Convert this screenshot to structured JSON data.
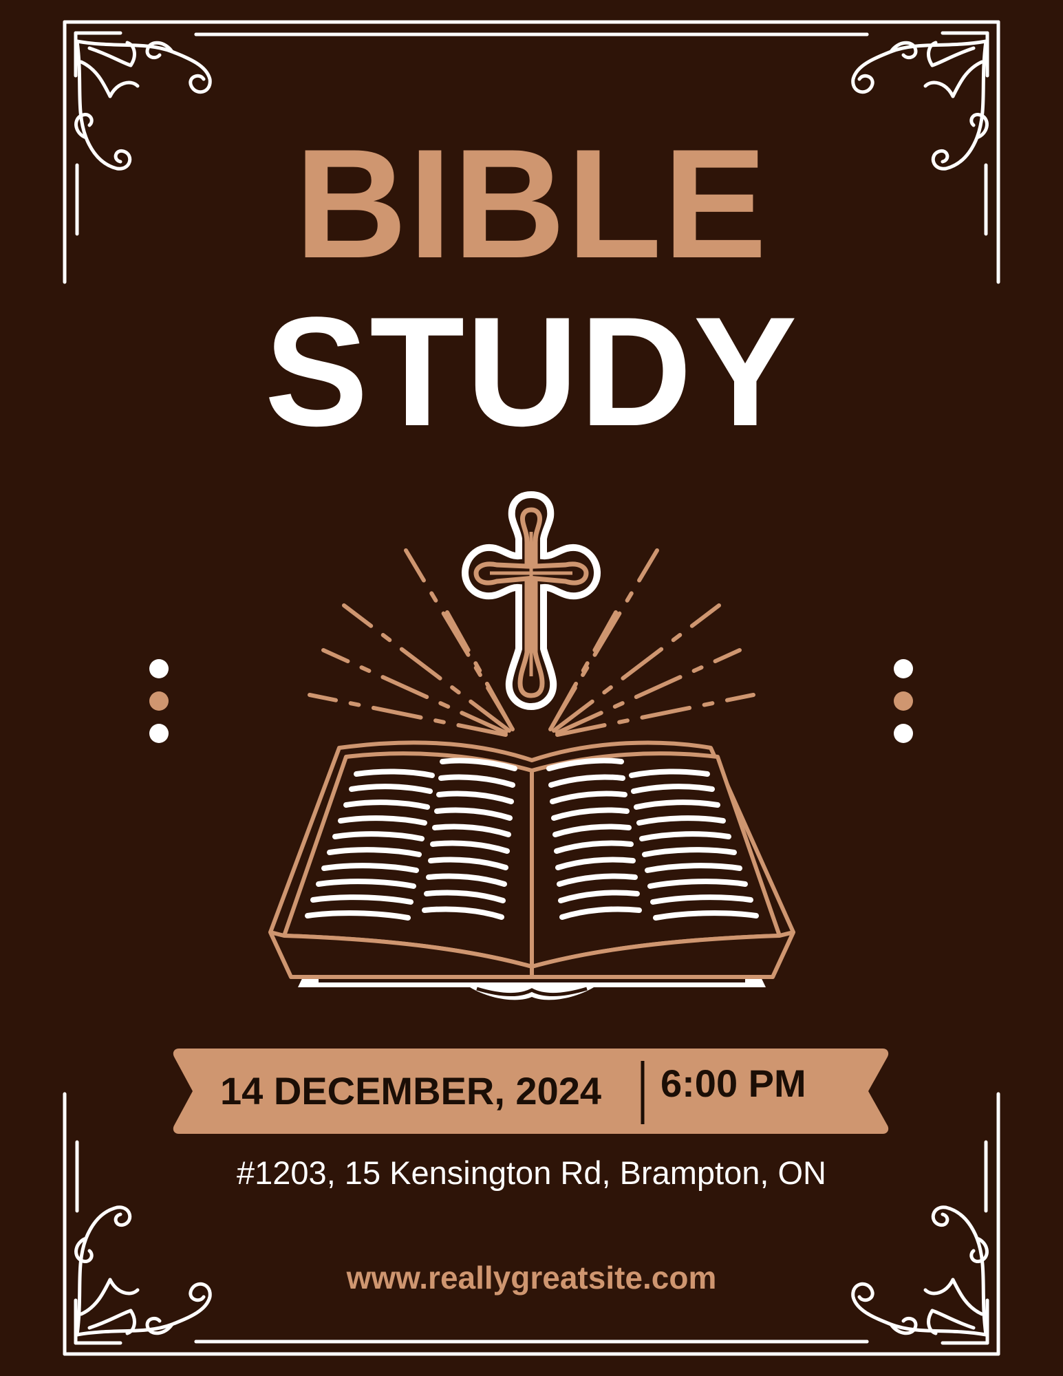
{
  "flyer": {
    "title_line1": "BIBLE",
    "title_line2": "STUDY",
    "date": "14 DECEMBER, 2024",
    "time": "6:00 PM",
    "address": "#1203, 15 Kensington Rd, Brampton, ON",
    "website": "www.reallygreatsite.com"
  },
  "colors": {
    "background": "#2e1408",
    "accent": "#cf9670",
    "white": "#ffffff",
    "dark_text": "#1b0e06"
  },
  "icons": [
    "corner-ornament-icon",
    "cross-icon",
    "open-bible-icon",
    "light-rays-icon",
    "dots-icon"
  ]
}
